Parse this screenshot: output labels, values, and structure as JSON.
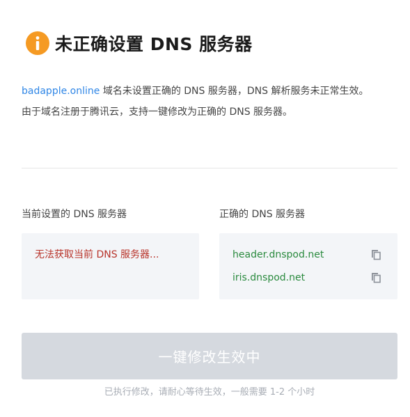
{
  "header": {
    "icon": "info-icon",
    "title": "未正确设置 DNS 服务器"
  },
  "description": {
    "domain": "badapple.online",
    "line1_rest": " 域名未设置正确的 DNS 服务器，DNS 解析服务未正常生效。",
    "line2": "由于域名注册于腾讯云，支持一键修改为正确的 DNS 服务器。"
  },
  "current_dns": {
    "label": "当前设置的 DNS 服务器",
    "status": "无法获取当前 DNS 服务器..."
  },
  "correct_dns": {
    "label": "正确的 DNS 服务器",
    "servers": [
      {
        "name": "header.dnspod.net",
        "icon": "copy-icon"
      },
      {
        "name": "iris.dnspod.net",
        "icon": "copy-icon"
      }
    ]
  },
  "action": {
    "button_label": "一键修改生效中",
    "hint": "已执行修改，请耐心等待生效，一般需要 1-2 个小时"
  },
  "colors": {
    "accent_orange": "#f59a23",
    "link_blue": "#2f86e6",
    "error_red": "#b8332a",
    "success_green": "#2a8a3e",
    "disabled_button": "#d5d9df"
  }
}
